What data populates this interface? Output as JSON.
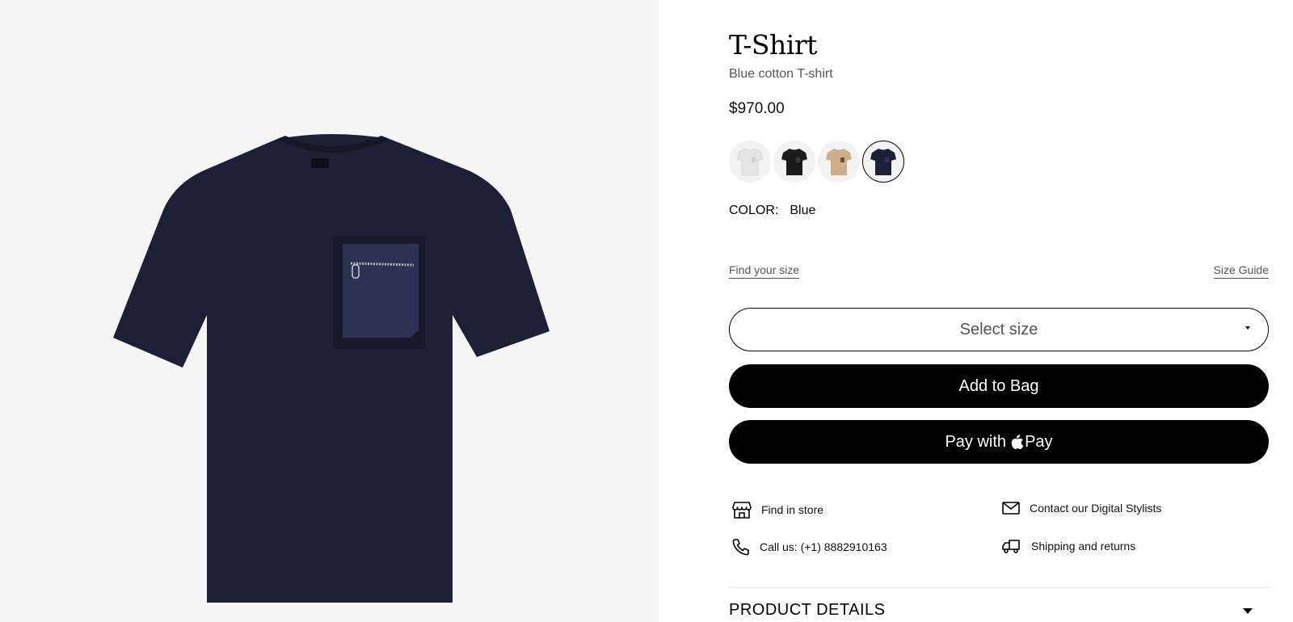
{
  "product": {
    "title": "T-Shirt",
    "subtitle": "Blue cotton T-shirt",
    "price": "$970.00",
    "color_label": "COLOR:",
    "color_value": "Blue",
    "swatches": [
      {
        "name": "white",
        "color": "#e9e9e9"
      },
      {
        "name": "black",
        "color": "#1b1b1b"
      },
      {
        "name": "beige",
        "color": "#cdb08a"
      },
      {
        "name": "blue",
        "color": "#1d2035",
        "selected": true
      }
    ]
  },
  "size": {
    "find_label": "Find your size",
    "guide_label": "Size Guide",
    "select_label": "Select size"
  },
  "actions": {
    "add_to_bag": "Add to Bag",
    "pay_with": "Pay with",
    "pay_brand": "Pay"
  },
  "services": {
    "find_store": "Find in store",
    "contact": "Contact our Digital Stylists",
    "call": "Call us: (+1) 8882910163",
    "shipping": "Shipping and returns"
  },
  "details": {
    "label": "PRODUCT DETAILS"
  },
  "colors": {
    "shirt": "#1d2035",
    "pocket": "#2b3253",
    "image_bg": "#f5f5f5"
  }
}
